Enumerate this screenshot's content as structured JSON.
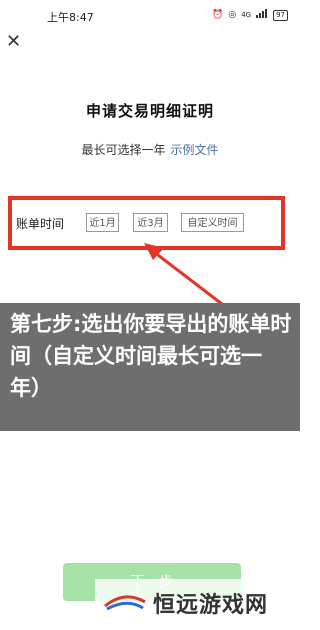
{
  "status_bar": {
    "time": "上午8:47",
    "network": "4G",
    "battery": "97"
  },
  "header": {
    "close_icon": "close-icon"
  },
  "main": {
    "title": "申请交易明细证明",
    "subtitle_text": "最长可选择一年",
    "sample_link": "示例文件",
    "bill_time_label": "账单时间",
    "range_options": [
      "近1月",
      "近3月",
      "自定义时间"
    ]
  },
  "annotation": {
    "text": "第七步:选出你要导出的账单时间（自定义时间最长可选一年）",
    "highlight_color": "#e53427"
  },
  "footer": {
    "next_button": "下一步"
  },
  "watermark": {
    "text": "恒远游戏网"
  }
}
